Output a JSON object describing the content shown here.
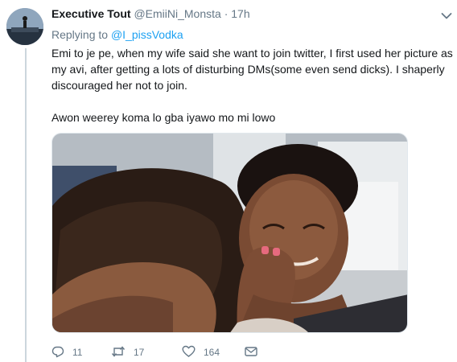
{
  "tweet": {
    "author_name": "Executive Tout",
    "author_handle": "@EmiiNi_Monsta",
    "separator": "·",
    "time": "17h",
    "replying_prefix": "Replying to",
    "replying_mention": "@I_pissVodka",
    "text_paragraph_1": "Emi to je pe, when my wife said she want to join twitter, I first used her picture as my avi, after getting a lots of disturbing DMs(some even send dicks). I shaperly discouraged her not to join.",
    "text_paragraph_2": "Awon weerey koma lo gba iyawo mo mi lowo",
    "reply_count": "11",
    "retweet_count": "17",
    "like_count": "164"
  },
  "icons": {
    "reply": "reply-icon",
    "retweet": "retweet-icon",
    "like": "heart-icon",
    "dm": "envelope-icon",
    "menu": "chevron-down-icon"
  },
  "colors": {
    "link": "#1da1f2",
    "secondary_text": "#657786",
    "primary_text": "#14171a",
    "thread_line": "#ccd6dd"
  }
}
